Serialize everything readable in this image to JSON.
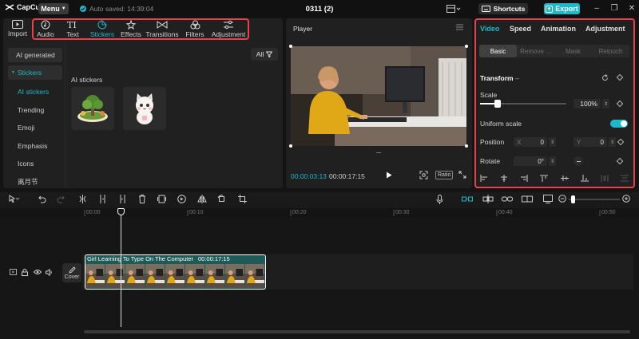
{
  "app": {
    "logo_text": "CapCut",
    "menu_label": "Menu",
    "autosave_text": "Auto saved: 14:39:04",
    "project_title": "0311 (2)",
    "shortcuts_label": "Shortcuts",
    "export_label": "Export",
    "accent_color": "#1fb8c8",
    "highlight_color": "#e8414b"
  },
  "toolbar": {
    "tabs": [
      {
        "label": "Import",
        "icon": "import-icon"
      },
      {
        "label": "Audio",
        "icon": "audio-icon"
      },
      {
        "label": "Text",
        "icon": "text-icon"
      },
      {
        "label": "Stickers",
        "icon": "stickers-icon",
        "active": true
      },
      {
        "label": "Effects",
        "icon": "effects-icon"
      },
      {
        "label": "Transitions",
        "icon": "transitions-icon"
      },
      {
        "label": "Filters",
        "icon": "filters-icon"
      },
      {
        "label": "Adjustment",
        "icon": "adjustment-icon"
      }
    ]
  },
  "sidebar": {
    "ai_generated": "AI generated",
    "stickers_head": "Stickers",
    "items": [
      "AI stickers",
      "Trending",
      "Emoji",
      "Emphasis",
      "Icons",
      "离月节"
    ]
  },
  "library": {
    "filter_label": "All",
    "section_title": "AI stickers"
  },
  "player": {
    "title": "Player",
    "current_time": "00:00:03:13",
    "total_time": "00:00:17:15",
    "ratio_label": "Ratio"
  },
  "inspector": {
    "tabs": [
      "Video",
      "Speed",
      "Animation",
      "Adjustment"
    ],
    "subtabs": [
      "Basic",
      "Remove ...",
      "Mask",
      "Retouch"
    ],
    "transform_title": "Transform",
    "scale_label": "Scale",
    "scale_value": "100%",
    "scale_fraction": 0.2,
    "uniform_scale_label": "Uniform scale",
    "uniform_scale_on": true,
    "position_label": "Position",
    "position_x_axis": "X",
    "position_x": "0",
    "position_y_axis": "Y",
    "position_y": "0",
    "rotate_label": "Rotate",
    "rotate_value": "0°"
  },
  "timeline": {
    "ticks": [
      "00:00",
      "00:10",
      "00:20",
      "00:30",
      "00:40",
      "00:50"
    ],
    "clip_title": "Girl Learning To Type On The Computer",
    "clip_duration": "00:00:17:15",
    "cover_label": "Cover"
  }
}
